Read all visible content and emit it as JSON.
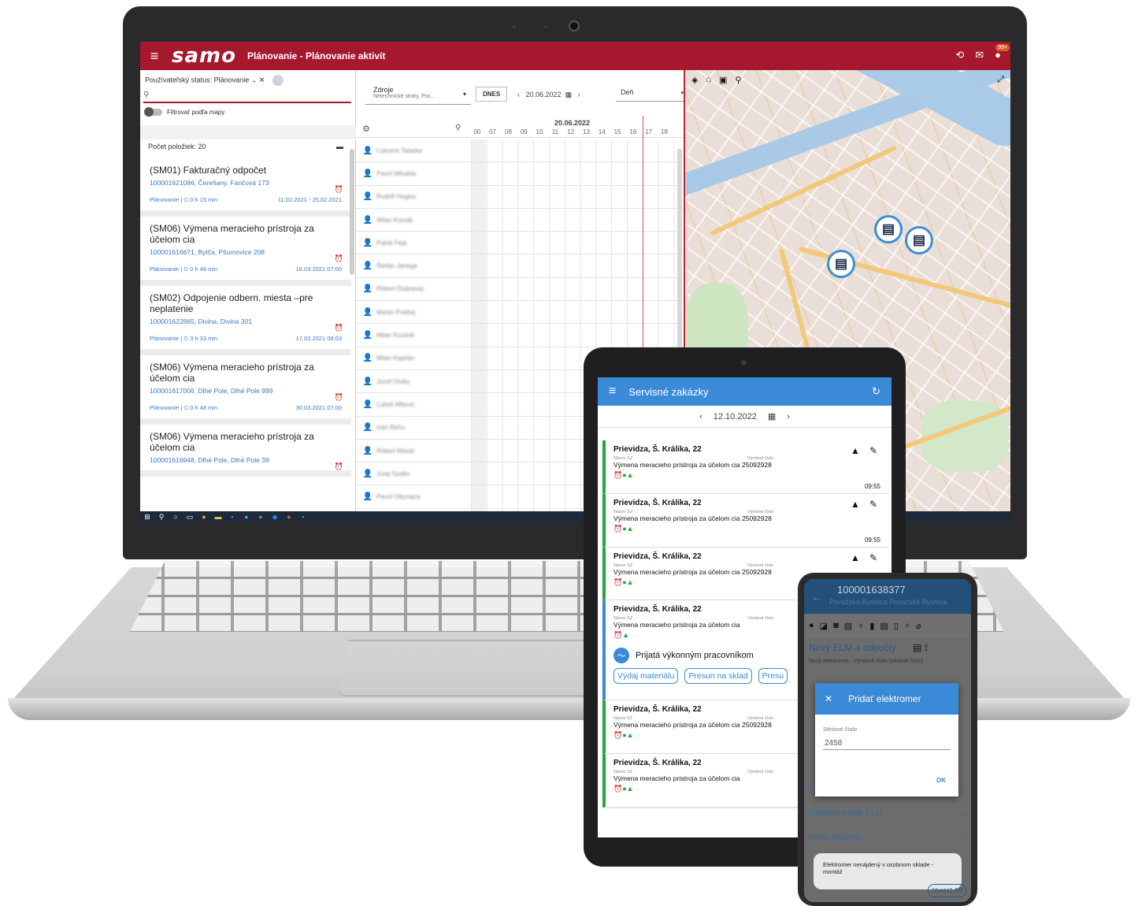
{
  "laptop": {
    "app": {
      "logo": "samo",
      "title": "Plánovanie - Plánovanie aktivít",
      "notif_badge": "99+"
    },
    "filter": {
      "chip": "Používateľský status: Plánovanie",
      "toggle_label": "Filtrovať podľa mapy",
      "count": "Počet položiek: 20"
    },
    "items": [
      {
        "title": "(SM01) Fakturačný odpočet",
        "sub": "100001621086, Čereňany, Fančová 173",
        "meta": "Plánovanie | ⏲ 0 h 15 min",
        "date": "11.02.2021 - 25.02.2021"
      },
      {
        "title": "(SM06) Výmena meracieho prístroja za účelom cia",
        "sub": "100001616671, Bytča, Pšurnovice 208",
        "meta": "Plánovanie | ⏲ 0 h 48 min",
        "date": "16.03.2021 07:00"
      },
      {
        "title": "(SM02) Odpojenie odbern. miesta –pre neplatenie",
        "sub": "100001622665, Divina, Divina 301",
        "meta": "Plánovanie | ⏲ 3 h 33 min",
        "date": "17.02.2021 08:03"
      },
      {
        "title": "(SM06) Výmena meracieho prístroja za účelom cia",
        "sub": "100001617006, Dlhé Pole, Dlhé Pole 999",
        "meta": "Plánovanie | ⏲ 0 h 48 min",
        "date": "30.03.2021 07:00"
      },
      {
        "title": "(SM06) Výmena meracieho prístroja za účelom cia",
        "sub": "100001616948, Dlhé Pole, Dlhé Pole 39",
        "meta": "",
        "date": ""
      }
    ],
    "planner": {
      "source_label": "Zdroje",
      "source_value": "Netechnické straty, Pra...",
      "today_button": "DNES",
      "date": "20.06.2022",
      "view": "Deň",
      "head_date": "20.06.2022",
      "hours": [
        "00",
        "07",
        "08",
        "09",
        "10",
        "11",
        "12",
        "13",
        "14",
        "15",
        "16",
        "17",
        "18"
      ],
      "resources": [
        "Ľubomír Tatarka",
        "Pavol Mihalda",
        "Rudolf Heglas",
        "Milan Kresák",
        "Patrik Feja",
        "Štefan Janega",
        "Róbert Dubravay",
        "Martin Priebej",
        "Milan Kozárik",
        "Milan Kapitán",
        "Jozef Diviky",
        "Ľuboš Mitovic",
        "Ivan Behu",
        "Róbert Masár",
        "Juraj Szabo",
        "Pavol Obyvajca"
      ]
    }
  },
  "tablet": {
    "title": "Servisné zakázky",
    "date": "12.10.2022",
    "label_name": "Názov SZ",
    "label_serial": "Výrobné číslo",
    "cards": [
      {
        "addr": "Prievidza, Š. Králika, 22",
        "desc": "Výmena meracieho prístroja za účelom cia",
        "serial": "25092928",
        "time": "09:55",
        "color": "green"
      },
      {
        "addr": "Prievidza, Š. Králika, 22",
        "desc": "Výmena meracieho prístroja za účelom cia",
        "serial": "25092928",
        "time": "09:55",
        "color": "green"
      },
      {
        "addr": "Prievidza, Š. Králika, 22",
        "desc": "Výmena meracieho prístroja za účelom cia",
        "serial": "25092928",
        "time": "",
        "color": "green"
      }
    ],
    "expanded": {
      "addr": "Prievidza, Š. Králika, 22",
      "desc": "Výmena meracieho prístroja za účelom cia",
      "status": "Prijatá výkonným pracovníkom",
      "buttons": [
        "Výdaj materiálu",
        "Presun na sklad",
        "Presu"
      ]
    },
    "cards_bottom": [
      {
        "addr": "Prievidza, Š. Králika, 22",
        "desc": "Výmena meracieho prístroja za účelom cia",
        "serial": "25092928"
      },
      {
        "addr": "Prievidza, Š. Králika, 22",
        "desc": "Výmena meracieho prístroja za účelom cia",
        "serial": ""
      }
    ]
  },
  "phone": {
    "title": "100001638377",
    "subtitle": "Považská Bystrica Považská Bystrica",
    "section": "Nový ELM a odpočty",
    "section_sub": "Nový elektromer - Výrobné číslo (sériové číslo)",
    "dialog_title": "Pridať elektromer",
    "dialog_label": "Sériové číslo",
    "dialog_value": "2458",
    "dialog_ok": "OK",
    "rows": [
      "Z",
      "Ostatné údaje ELM",
      "Nové odpočty"
    ],
    "toast": "Elektromer nenájdený v osobnom sklade - montáž",
    "montaz_button": "Montáž AB"
  },
  "colors": {
    "brand": "#a5182e",
    "mobile_accent": "#3b8ad8",
    "status_green": "#29a33b"
  }
}
